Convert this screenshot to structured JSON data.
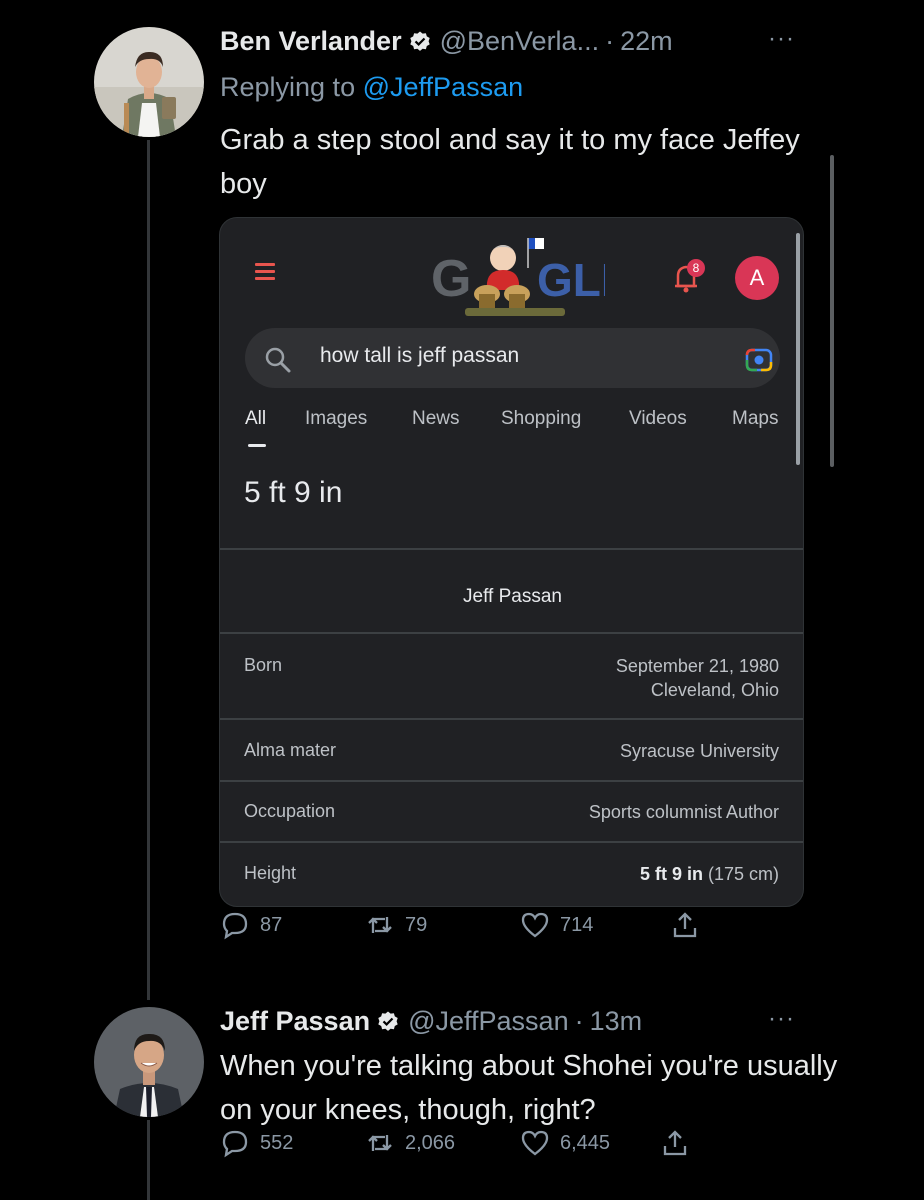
{
  "tweets": [
    {
      "author_name": "Ben Verlander",
      "handle": "@BenVerla...",
      "separator": "·",
      "time": "22m",
      "more": "···",
      "reply_prefix": "Replying to",
      "reply_handle": "@JeffPassan",
      "text": "Grab a step stool and say it to my face Jeffey boy",
      "replies": "87",
      "retweets": "79",
      "likes": "714"
    },
    {
      "author_name": "Jeff Passan",
      "handle": "@JeffPassan",
      "separator": "·",
      "time": "13m",
      "more": "···",
      "text": "When you're talking about Shohei you're usually on your knees, though, right?",
      "replies": "552",
      "retweets": "2,066",
      "likes": "6,445"
    }
  ],
  "google": {
    "notification_count": "8",
    "account_initial": "A",
    "query": "how tall is jeff passan",
    "tabs": [
      "All",
      "Images",
      "News",
      "Shopping",
      "Videos",
      "Maps"
    ],
    "answer": "5 ft 9 in",
    "panel_title": "Jeff Passan",
    "rows": [
      {
        "label": "Born",
        "value_line1": "September 21, 1980",
        "value_line2": "Cleveland, Ohio"
      },
      {
        "label": "Alma mater",
        "value": "Syracuse University"
      },
      {
        "label": "Occupation",
        "value": "Sports columnist Author"
      },
      {
        "label": "Height",
        "value_bold": "5 ft 9 in",
        "value_rest": " (175 cm)"
      }
    ]
  },
  "colors": {
    "background": "#000000",
    "link_blue": "#1d9bf0",
    "muted": "#8b98a5",
    "verified_badge": "#e7e9ea",
    "google_avatar": "#d93656",
    "google_menu": "#e8554e"
  },
  "icons": [
    "verified-icon",
    "more-icon",
    "reply-icon",
    "retweet-icon",
    "like-icon",
    "share-icon",
    "menu-icon",
    "bell-icon",
    "search-icon",
    "camera-icon"
  ]
}
